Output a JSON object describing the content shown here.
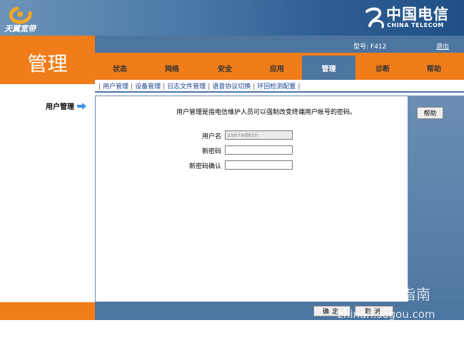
{
  "header": {
    "brand_text": "天翼宽带",
    "telecom_cn": "中国电信",
    "telecom_en": "CHINA TELECOM",
    "model_label": "型号: F412",
    "logout": "退出"
  },
  "page_title": "管理",
  "nav": {
    "tabs": [
      "状态",
      "网络",
      "安全",
      "应用",
      "管理",
      "诊断",
      "帮助"
    ],
    "active_tab": "管理"
  },
  "subnav": [
    "用户管理",
    "设备管理",
    "日志文件管理",
    "语音协议切换",
    "环回检测配置"
  ],
  "sidebar": {
    "item": "用户管理"
  },
  "main": {
    "description": "用户管理是指电信维护人员可以强制改变终端用户帐号的密码。",
    "form": {
      "username_label": "用户名",
      "username_value": "useradmin",
      "new_password_label": "新密码",
      "confirm_password_label": "新密码确认"
    }
  },
  "right": {
    "help_button": "帮助"
  },
  "footer": {
    "confirm_button": "确定",
    "cancel_button": "取消"
  },
  "watermark": {
    "cn": "搜狗指南",
    "en": "zhinan.sogou.com"
  },
  "colors": {
    "orange": "#f07d1a",
    "blue": "#4c75a0",
    "link_blue": "#1a3f8f"
  }
}
